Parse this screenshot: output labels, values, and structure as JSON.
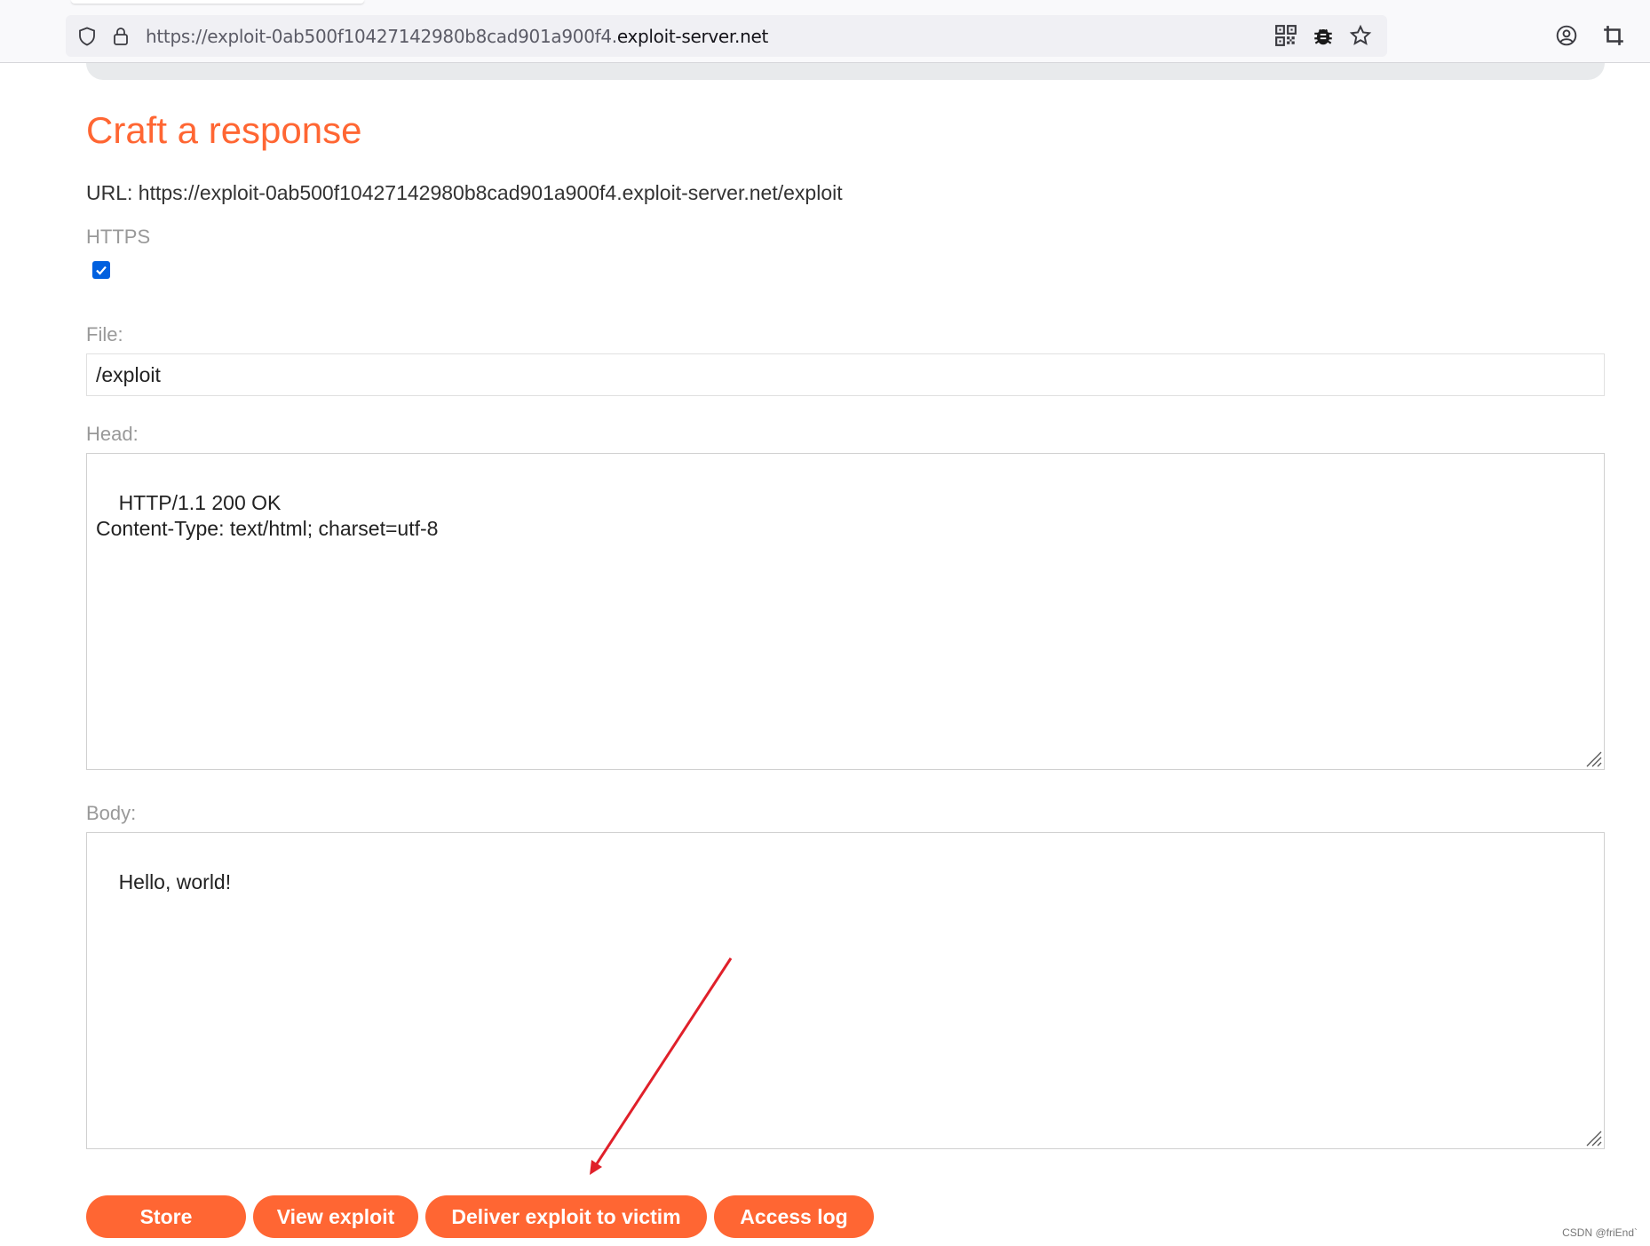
{
  "browser": {
    "url_prefix": "https://exploit-0ab500f10427142980b8cad901a900f4.",
    "url_domain": "exploit-server.net"
  },
  "page": {
    "title": "Craft a response",
    "url_line": "URL: https://exploit-0ab500f10427142980b8cad901a900f4.exploit-server.net/exploit",
    "https_label": "HTTPS",
    "https_checked": true,
    "file_label": "File:",
    "file_value": "/exploit",
    "head_label": "Head:",
    "head_value": "HTTP/1.1 200 OK\nContent-Type: text/html; charset=utf-8",
    "body_label": "Body:",
    "body_value": "Hello, world!"
  },
  "buttons": {
    "store": "Store",
    "view": "View exploit",
    "deliver": "Deliver exploit to victim",
    "access_log": "Access log"
  },
  "watermark": "CSDN @friEnd`",
  "colors": {
    "accent": "#ff6633",
    "annotation_arrow": "#e0202a",
    "checkbox": "#0060df"
  }
}
